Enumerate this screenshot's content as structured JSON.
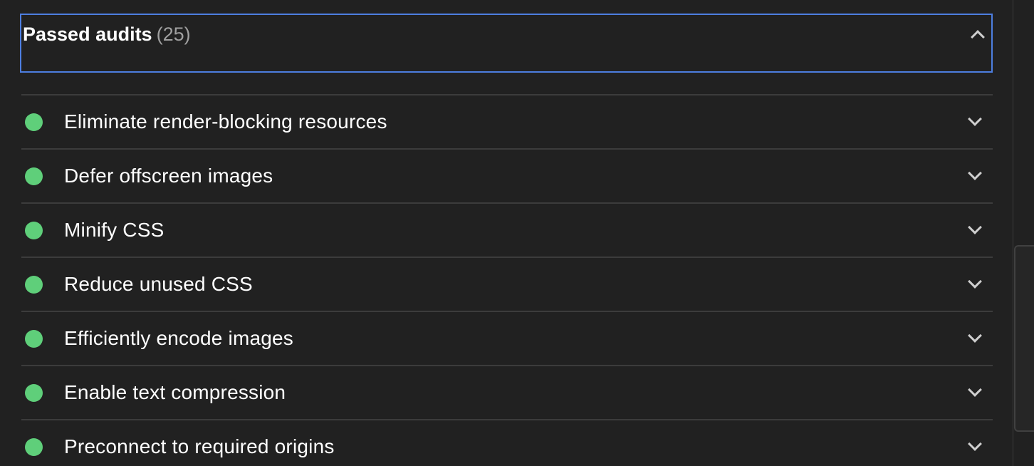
{
  "group": {
    "title": "Passed audits",
    "count": "(25)",
    "expanded": true,
    "toggle_icon": "chevron-up-icon",
    "focus_color": "#4d7ee0"
  },
  "audits": [
    {
      "label": "Eliminate render-blocking resources",
      "status": "pass",
      "status_color": "#5fcf7a"
    },
    {
      "label": "Defer offscreen images",
      "status": "pass",
      "status_color": "#5fcf7a"
    },
    {
      "label": "Minify CSS",
      "status": "pass",
      "status_color": "#5fcf7a"
    },
    {
      "label": "Reduce unused CSS",
      "status": "pass",
      "status_color": "#5fcf7a"
    },
    {
      "label": "Efficiently encode images",
      "status": "pass",
      "status_color": "#5fcf7a"
    },
    {
      "label": "Enable text compression",
      "status": "pass",
      "status_color": "#5fcf7a"
    },
    {
      "label": "Preconnect to required origins",
      "status": "pass",
      "status_color": "#5fcf7a"
    }
  ],
  "theme": {
    "background": "#212121",
    "divider": "#3c3c3c",
    "text": "#ffffff",
    "muted_text": "#a0a0a0"
  }
}
